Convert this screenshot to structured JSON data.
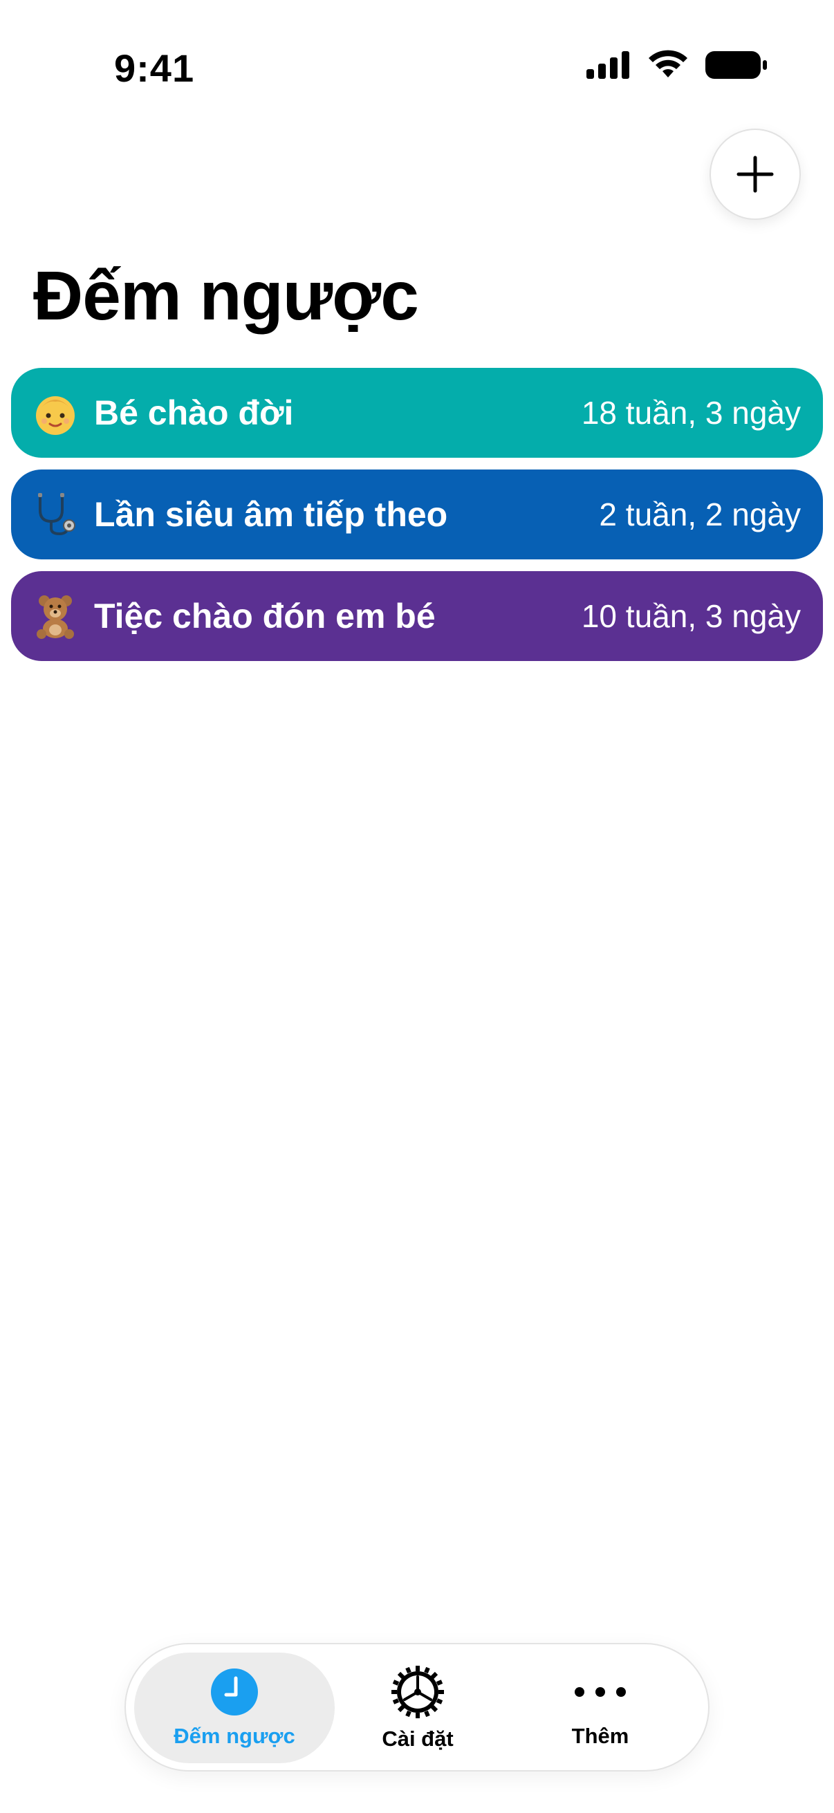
{
  "status_bar": {
    "time": "9:41"
  },
  "header": {
    "title": "Đếm ngược",
    "add_icon": "plus-icon"
  },
  "countdowns": [
    {
      "emoji_icon": "baby-face-icon",
      "title": "Bé chào đời",
      "remaining": "18 tuần, 3 ngày",
      "color": "#04ADAB"
    },
    {
      "emoji_icon": "stethoscope-icon",
      "title": "Lần siêu âm tiếp theo",
      "remaining": "2 tuần, 2 ngày",
      "color": "#0760B4"
    },
    {
      "emoji_icon": "teddy-bear-icon",
      "title": "Tiệc chào đón em bé",
      "remaining": "10 tuần, 3 ngày",
      "color": "#5B3092"
    }
  ],
  "tab_bar": {
    "active_color": "#1A9FF0",
    "tabs": [
      {
        "label": "Đếm ngược",
        "icon": "clock-icon",
        "active": true
      },
      {
        "label": "Cài đặt",
        "icon": "gear-icon",
        "active": false
      },
      {
        "label": "Thêm",
        "icon": "more-dots-icon",
        "active": false
      }
    ]
  }
}
